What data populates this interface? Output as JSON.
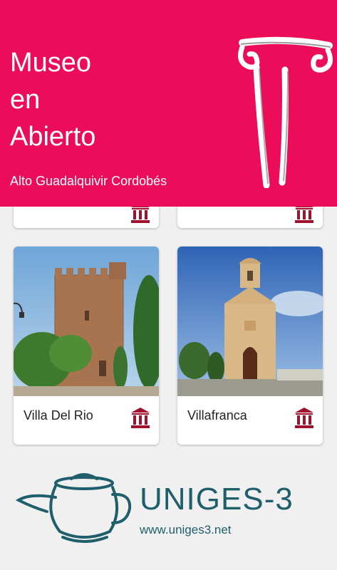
{
  "header": {
    "title": "Museo\nen\nAbierto",
    "subtitle": "Alto Guadalquivir Cordobés",
    "background": "#ec0d5a",
    "logo_icon": "ionic-column-icon"
  },
  "cards": [
    {
      "name": "",
      "icon": "museum-icon"
    },
    {
      "name": "",
      "icon": "museum-icon"
    },
    {
      "name": "Villa Del Rio",
      "icon": "museum-icon",
      "photo": "castle-tower-photo"
    },
    {
      "name": "Villafranca",
      "icon": "museum-icon",
      "photo": "church-facade-photo"
    }
  ],
  "footer": {
    "brand": "UNIGES-3",
    "url": "www.uniges3.net",
    "logo_icon": "teapot-icon",
    "color": "#1f5f6b"
  },
  "accent": "#a0112c"
}
